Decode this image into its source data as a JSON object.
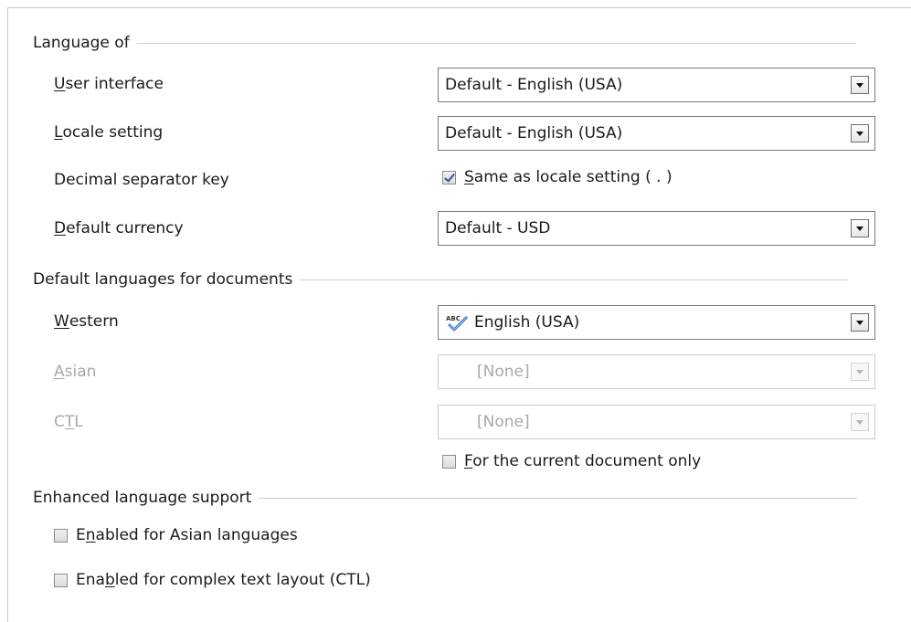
{
  "language_of": {
    "header": "Language of",
    "user_interface": {
      "label_u": "U",
      "label_rest": "ser interface",
      "value": "Default - English (USA)"
    },
    "locale_setting": {
      "label_u": "L",
      "label_rest": "ocale setting",
      "value": "Default - English (USA)"
    },
    "decimal_separator": {
      "label": "Decimal separator key",
      "checkbox_u": "S",
      "checkbox_rest": "ame as locale setting ( . )",
      "checked": true
    },
    "default_currency": {
      "label_u": "D",
      "label_rest": "efault currency",
      "value": "Default - USD"
    }
  },
  "default_languages": {
    "header": "Default languages for documents",
    "western": {
      "label_u": "W",
      "label_rest": "estern",
      "value": "English (USA)",
      "icon": "spellcheck-abc-icon"
    },
    "asian": {
      "label_u": "A",
      "label_rest": "sian",
      "value": "[None]",
      "disabled": true
    },
    "ctl": {
      "label_pre": "C",
      "label_u": "T",
      "label_rest": "L",
      "value": "[None]",
      "disabled": true
    },
    "current_doc_only": {
      "label_u": "F",
      "label_rest": "or the current document only",
      "checked": false
    }
  },
  "enhanced": {
    "header": "Enhanced language support",
    "asian": {
      "label_pre": "E",
      "label_u": "n",
      "label_rest": "abled for Asian languages",
      "checked": false
    },
    "ctl": {
      "label_pre": "Ena",
      "label_u": "b",
      "label_rest": "led for complex text layout (CTL)",
      "checked": false
    }
  },
  "colors": {
    "border": "#7a7a7a",
    "disabled_text": "#a8a8a8",
    "check_mark": "#2f4f99"
  }
}
